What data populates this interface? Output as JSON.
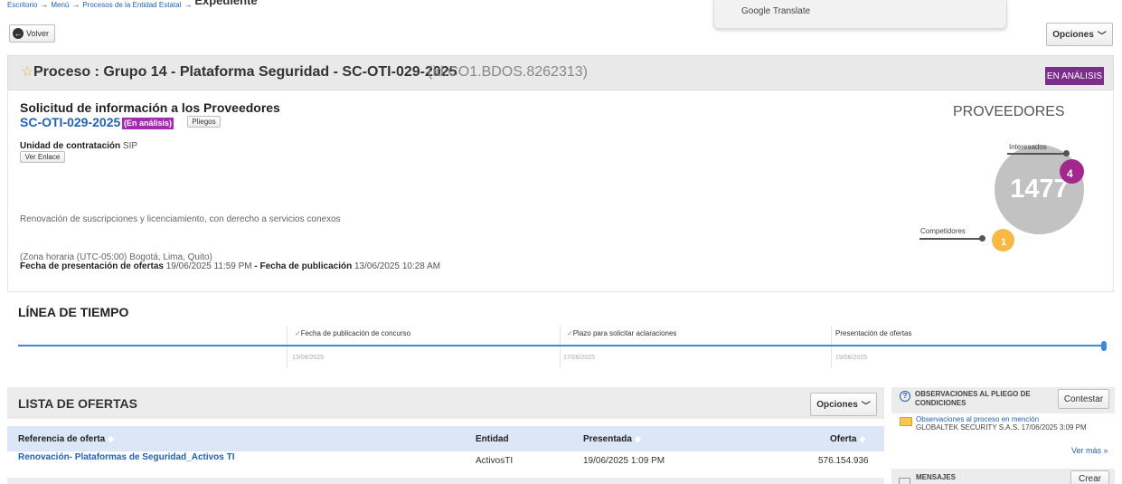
{
  "breadcrumb": {
    "items": [
      "Escritorio",
      "Menú",
      "Procesos de la Entidad Estatal"
    ],
    "current": "Expediente"
  },
  "google_translate": {
    "label": "Google Translate"
  },
  "toolbar": {
    "back_label": "Volver",
    "options_label": "Opciones"
  },
  "process": {
    "title": "Proceso : Grupo 14 - Plataforma Seguridad - SC-OTI-029-2025",
    "id": "(id.CO1.BDOS.8262313)",
    "status": "EN ANÁLISIS"
  },
  "solicitud": {
    "title": "Solicitud de información a los Proveedores",
    "code": "SC-OTI-029-2025",
    "status_badge": "(En análisis)",
    "pliegos_label": "Pliegos",
    "unidad_label": "Unidad de contratación",
    "unidad_value": "SIP",
    "ver_enlace_label": "Ver Enlace",
    "description": "Renovación de suscripciones y licenciamiento, con derecho a servicios conexos",
    "timezone": "(Zona horaria (UTC-05:00) Bogotá, Lima, Quito)",
    "fecha_presentacion_label": "Fecha de presentación de ofertas",
    "fecha_presentacion_value": "19/06/2025 11:59 PM",
    "fecha_publicacion_label": "Fecha de publicación",
    "fecha_publicacion_value": "13/06/2025 10:28 AM"
  },
  "proveedores": {
    "title": "PROVEEDORES",
    "total": "1477",
    "interesados_label": "Interesados",
    "interesados_count": "4",
    "competidores_label": "Competidores",
    "competidores_count": "1"
  },
  "timeline": {
    "title": "LÍNEA DE TIEMPO",
    "events": [
      {
        "label": "Fecha de publicación de concurso",
        "date": "13/06/2025",
        "done": true
      },
      {
        "label": "Plazo para solicitar aclaraciones",
        "date": "17/06/2025",
        "done": true
      },
      {
        "label": "Presentación de ofertas",
        "date": "19/06/2025",
        "done": false
      }
    ]
  },
  "offers": {
    "title": "LISTA DE OFERTAS",
    "options_label": "Opciones",
    "columns": [
      "Referencia de oferta",
      "Entidad",
      "Presentada",
      "Oferta"
    ],
    "rows": [
      {
        "reference": "Renovación- Plataformas de Seguridad_Activos TI",
        "entity": "ActivosTI",
        "submitted": "19/06/2025 1:09 PM",
        "amount": "576.154.936"
      }
    ]
  },
  "observations": {
    "title": "OBSERVACIONES AL PLIEGO DE CONDICIONES",
    "reply_label": "Contestar",
    "item_link": "Observaciones al proceso en mención",
    "item_meta": "GLOBALTEK SECURITY S.A.S. 17/06/2025 3:09 PM",
    "more_label": "Ver más »"
  },
  "messages": {
    "title": "MENSAJES",
    "create_label": "Crear"
  },
  "colors": {
    "link": "#1f62b6",
    "status_purple": "#7b2f8a",
    "interesados": "#a3288d",
    "competidores": "#f7b845",
    "timeline": "#3d8ad6"
  }
}
